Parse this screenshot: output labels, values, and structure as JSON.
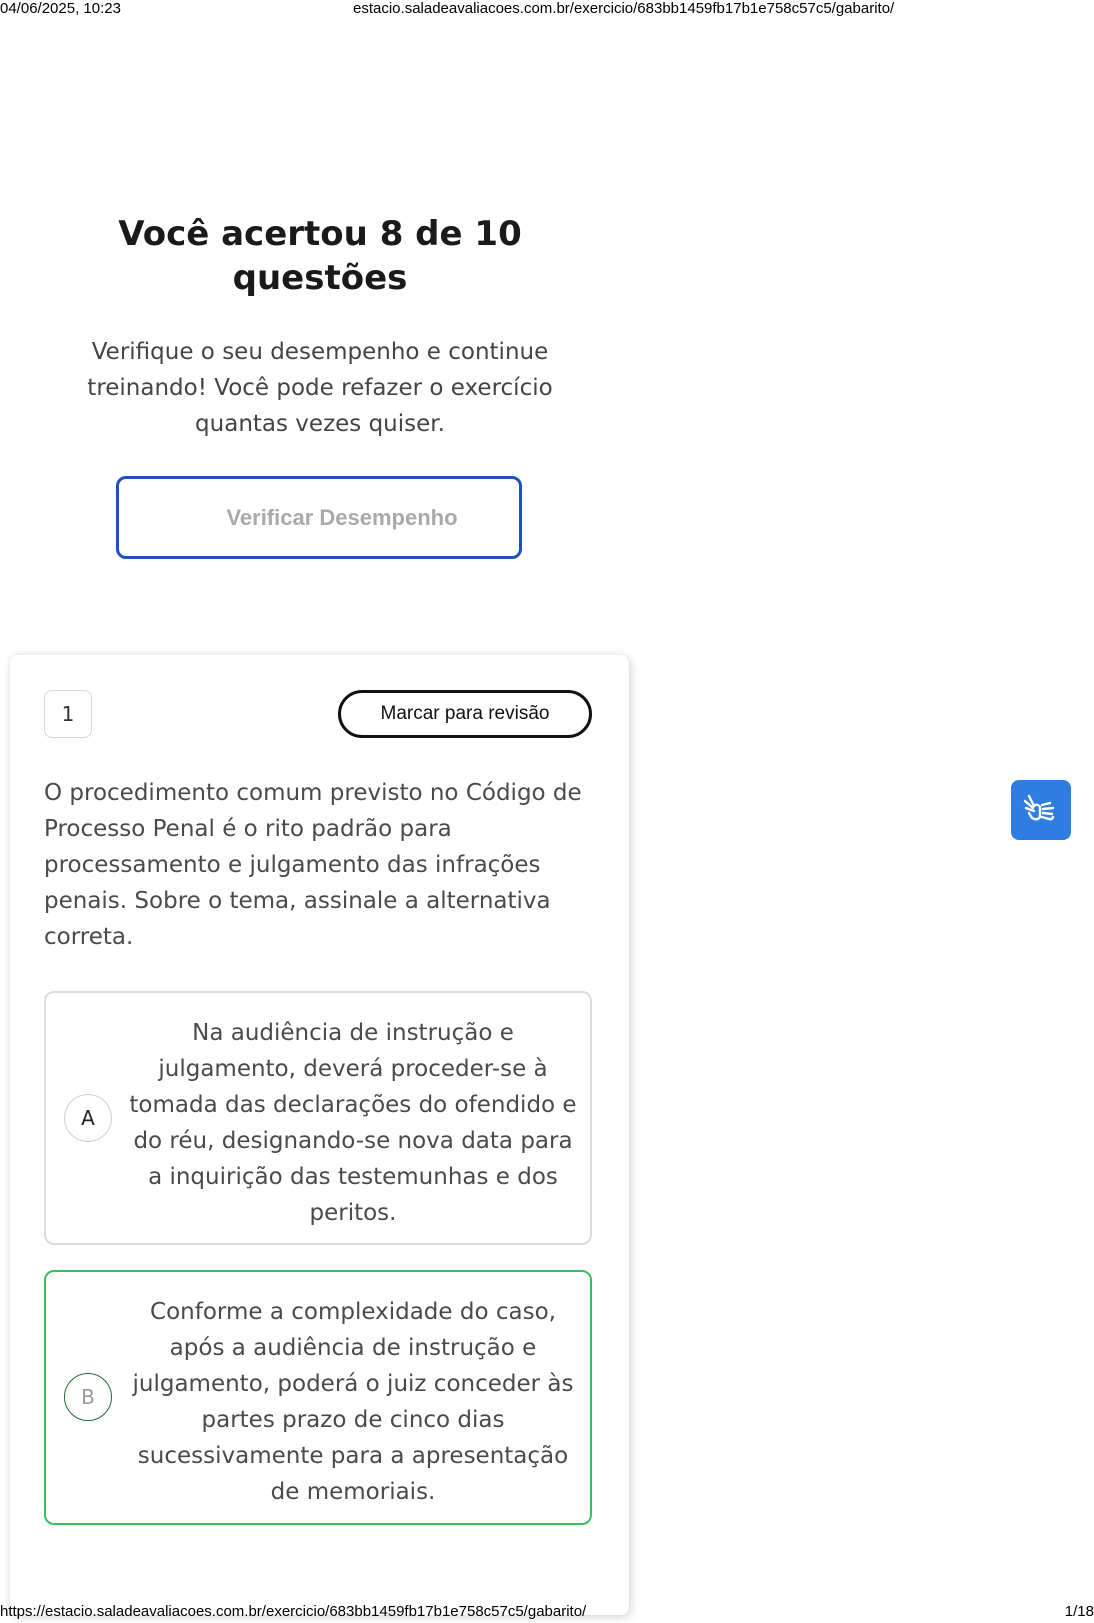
{
  "print": {
    "datetime": "04/06/2025, 10:23",
    "host_path": "estacio.saladeavaliacoes.com.br/exercicio/683bb1459fb17b1e758c57c5/gabarito/",
    "full_url": "https://estacio.saladeavaliacoes.com.br/exercicio/683bb1459fb17b1e758c57c5/gabarito/",
    "page_count": "1/18"
  },
  "result": {
    "title": "Você acertou 8 de 10 questões",
    "subtitle": "Verifique o seu desempenho e continue treinando! Você pode refazer o exercício quantas vezes quiser.",
    "verify_button": "Verificar Desempenho"
  },
  "question": {
    "number": "1",
    "review_button": "Marcar para revisão",
    "text": "O procedimento comum previsto no Código de Processo Penal é o rito padrão para processamento e julgamento das infrações penais. Sobre o tema, assinale a alternativa correta.",
    "options": [
      {
        "letter": "A",
        "text": "Na audiência de instrução e julgamento, deverá proceder-se à tomada das declarações do ofendido e do réu, designando-se nova data para a inquirição das testemunhas e dos peritos."
      },
      {
        "letter": "B",
        "text": "Conforme a complexidade do caso, após a audiência de instrução e julgamento, poderá o juiz conceder às partes prazo de cinco dias sucessivamente para a apresentação de memoriais."
      }
    ]
  },
  "colors": {
    "accent_blue": "#1e4fc8",
    "correct_green": "#38c05a",
    "vlibras_blue": "#2f7de1"
  },
  "icons": {
    "accessibility": "sign-language-hands-icon"
  }
}
